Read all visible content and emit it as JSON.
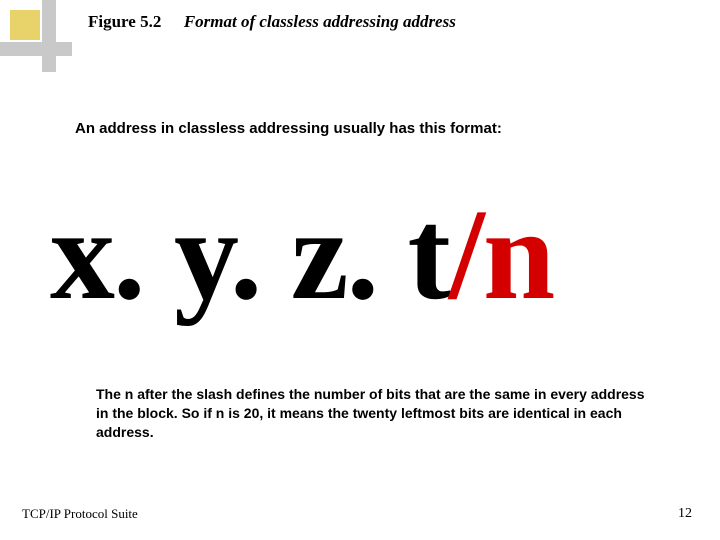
{
  "header": {
    "figure_label": "Figure 5.2",
    "figure_title": "Format of classless addressing address"
  },
  "intro_text": "An address in classless addressing usually has this format:",
  "format": {
    "black_part": "x. y. z. t",
    "red_part": "/n"
  },
  "explanation": "The n after the slash defines the number of bits that are the same in every address in the block.  So if n is 20, it means the twenty leftmost bits are identical in each address.",
  "footer": {
    "left": "TCP/IP Protocol Suite",
    "page_number": "12"
  }
}
